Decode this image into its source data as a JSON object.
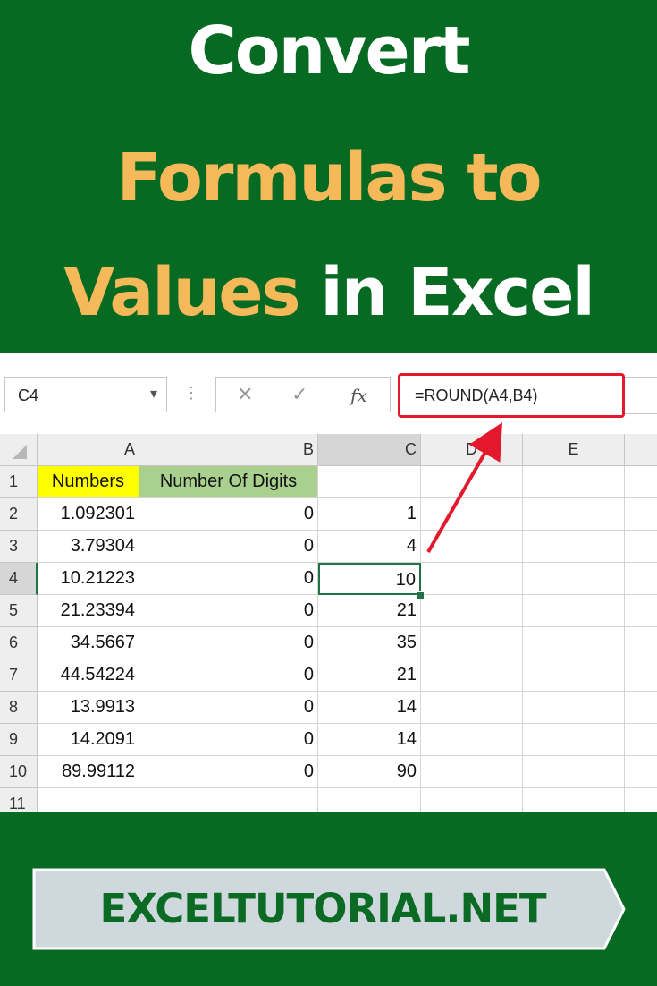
{
  "title": {
    "line1": "Convert",
    "line2": "Formulas to",
    "line3_accent": "Values",
    "line3_rest": "in Excel"
  },
  "formula_bar": {
    "name_box": "C4",
    "cancel_icon": "✕",
    "enter_icon": "✓",
    "fx_label": "fx",
    "formula": "=ROUND(A4,B4)"
  },
  "columns": [
    "A",
    "B",
    "C",
    "D",
    "E"
  ],
  "rows": [
    {
      "n": "1",
      "a": "Numbers",
      "b": "Number Of Digits",
      "c": ""
    },
    {
      "n": "2",
      "a": "1.092301",
      "b": "0",
      "c": "1"
    },
    {
      "n": "3",
      "a": "3.79304",
      "b": "0",
      "c": "4"
    },
    {
      "n": "4",
      "a": "10.21223",
      "b": "0",
      "c": "10"
    },
    {
      "n": "5",
      "a": "21.23394",
      "b": "0",
      "c": "21"
    },
    {
      "n": "6",
      "a": "34.5667",
      "b": "0",
      "c": "35"
    },
    {
      "n": "7",
      "a": "44.54224",
      "b": "0",
      "c": "21"
    },
    {
      "n": "8",
      "a": "13.9913",
      "b": "0",
      "c": "14"
    },
    {
      "n": "9",
      "a": "14.2091",
      "b": "0",
      "c": "14"
    },
    {
      "n": "10",
      "a": "89.99112",
      "b": "0",
      "c": "90"
    },
    {
      "n": "11",
      "a": "",
      "b": "",
      "c": ""
    }
  ],
  "colors": {
    "background": "#076a22",
    "accent": "#f6b95a",
    "highlight_arrow": "#e3182d",
    "header_yellow": "#ffff00",
    "header_green": "#a9d08e",
    "selection": "#217346"
  },
  "footer": {
    "brand": "EXCELTUTORIAL.NET"
  }
}
